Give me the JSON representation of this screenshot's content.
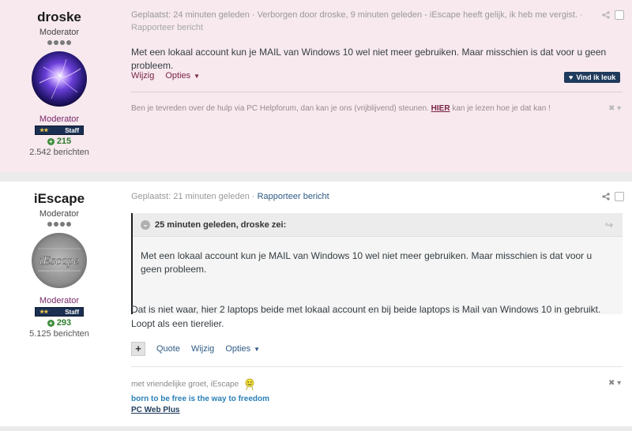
{
  "post1": {
    "author": "droske",
    "title": "Moderator",
    "group": "Moderator",
    "badge_label": "Staff",
    "reputation": "215",
    "post_count": "2.542 berichten",
    "meta": "Geplaatst: 24 minuten geleden · Verborgen door droske, 9 minuten geleden - iEscape heeft gelijk, ik heb me vergist. ·",
    "report": "Rapporteer bericht",
    "body": "Met een lokaal account kun je MAIL van Windows 10 wel niet meer gebruiken. Maar misschien is dat voor u geen probleem.",
    "edit_label": "Wijzig",
    "options_label": "Opties",
    "like_label": "Vind ik leuk",
    "signature_pre": "Ben je tevreden over de hulp via PC Helpforum, dan kan je ons (vrijblijvend) steunen.",
    "signature_link": "HIER",
    "signature_post": "kan je lezen hoe je dat kan !"
  },
  "post2": {
    "author": "iEscape",
    "title": "Moderator",
    "group": "Moderator",
    "badge_label": "Staff",
    "reputation": "293",
    "post_count": "5.125 berichten",
    "meta": "Geplaatst: 21 minuten geleden ·",
    "report": "Rapporteer bericht",
    "quote_header": "25 minuten geleden, droske zei:",
    "quote_body": "Met een lokaal account kun je MAIL van Windows 10 wel niet meer gebruiken. Maar misschien is dat voor u geen probleem.",
    "body_line1": "Dat is niet waar, hier 2 laptops beide met lokaal account en bij beide laptops is Mail van Windows 10 in gebruikt.",
    "body_line2": "Loopt als een tierelier.",
    "plus_label": "+",
    "quote_label": "Quote",
    "edit_label": "Wijzig",
    "options_label": "Opties",
    "sig_greeting": "met vriendelijke groet, iEscape",
    "sig_motto": "born to be free is the way to freedom",
    "sig_link": "PC Web Plus"
  },
  "colors": {
    "accent": "#7a2346",
    "link": "#2f5b86",
    "badge": "#1a2f52"
  },
  "icons": [
    "share-icon",
    "heart-icon",
    "caret-down-icon",
    "close-icon",
    "reputation-icon",
    "quote-chevron-icon",
    "reply-arrow-icon",
    "smiley-icon"
  ]
}
